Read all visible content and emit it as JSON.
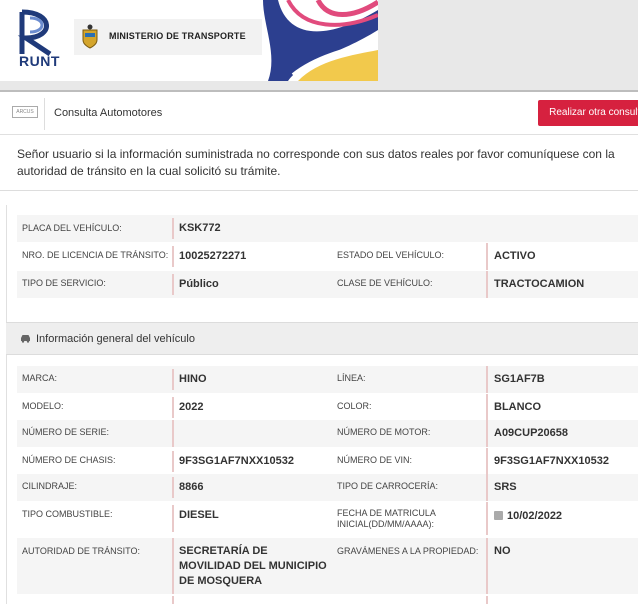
{
  "header": {
    "logo_text": "RUNT",
    "ministry": "MINISTERIO DE TRANSPORTE"
  },
  "topbar": {
    "title": "Consulta Automotores",
    "new_query_button": "Realizar otra consulta"
  },
  "notice": "Señor usuario si la información suministrada no corresponde con sus datos reales por favor comuníquese con la autoridad de tránsito en la cual solicitó su trámite.",
  "summary": {
    "placa_label": "PLACA DEL VEHÍCULO:",
    "placa_value": "KSK772",
    "licencia_label": "NRO. DE LICENCIA DE TRÁNSITO:",
    "licencia_value": "10025272271",
    "estado_label": "ESTADO DEL VEHÍCULO:",
    "estado_value": "ACTIVO",
    "servicio_label": "TIPO DE SERVICIO:",
    "servicio_value": "Público",
    "clase_label": "CLASE DE VEHÍCULO:",
    "clase_value": "TRACTOCAMION"
  },
  "general": {
    "title": "Información general del vehículo",
    "marca_label": "MARCA:",
    "marca_value": "HINO",
    "linea_label": "LÍNEA:",
    "linea_value": "SG1AF7B",
    "modelo_label": "MODELO:",
    "modelo_value": "2022",
    "color_label": "COLOR:",
    "color_value": "BLANCO",
    "serie_label": "NÚMERO DE SERIE:",
    "serie_value": "",
    "motor_label": "NÚMERO DE MOTOR:",
    "motor_value": "A09CUP20658",
    "chasis_label": "NÚMERO DE CHASIS:",
    "chasis_value": "9F3SG1AF7NXX10532",
    "vin_label": "NÚMERO DE VIN:",
    "vin_value": "9F3SG1AF7NXX10532",
    "cilindraje_label": "CILINDRAJE:",
    "cilindraje_value": "8866",
    "carroceria_label": "TIPO DE CARROCERÍA:",
    "carroceria_value": "SRS",
    "combustible_label": "TIPO COMBUSTIBLE:",
    "combustible_value": "DIESEL",
    "matricula_label": "FECHA DE MATRICULA INICIAL(DD/MM/AAAA):",
    "matricula_value": "10/02/2022",
    "autoridad_label": "AUTORIDAD DE TRÁNSITO:",
    "autoridad_value": "SECRETARÍA DE MOVILIDAD DEL MUNICIPIO DE MOSQUERA",
    "gravamenes_label": "GRAVÁMENES A LA PROPIEDAD:",
    "gravamenes_value": "NO"
  },
  "colors": {
    "accent_red": "#d6213f",
    "runt_blue": "#1f3a7a"
  }
}
